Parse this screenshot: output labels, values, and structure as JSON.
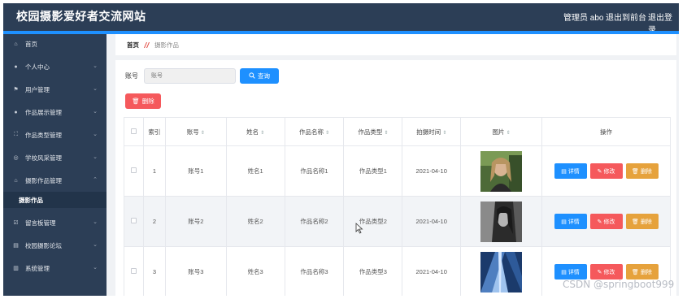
{
  "header": {
    "site_title": "校园摄影爱好者交流网站",
    "admin_label": "管理员 abo",
    "front_link": "退出到前台",
    "logout_link": "退出登录"
  },
  "sidebar": {
    "items": [
      {
        "label": "首页",
        "icon": "home-icon"
      },
      {
        "label": "个人中心",
        "icon": "user-icon"
      },
      {
        "label": "用户管理",
        "icon": "flag-icon"
      },
      {
        "label": "作品展示管理",
        "icon": "user-icon"
      },
      {
        "label": "作品类型管理",
        "icon": "fullscreen-icon"
      },
      {
        "label": "学校风采管理",
        "icon": "compass-icon"
      },
      {
        "label": "摄影作品管理",
        "icon": "bank-icon"
      },
      {
        "label": "摄影作品",
        "icon": ""
      },
      {
        "label": "留言板管理",
        "icon": "checkbox-icon"
      },
      {
        "label": "校园摄影论坛",
        "icon": "document-icon"
      },
      {
        "label": "系统管理",
        "icon": "chart-icon"
      }
    ]
  },
  "breadcrumb": {
    "home": "首页",
    "current": "摄影作品"
  },
  "search": {
    "label": "账号",
    "placeholder": "账号",
    "query_button": "查询"
  },
  "toolbar": {
    "delete_button": "删除"
  },
  "table": {
    "headers": [
      "索引",
      "账号",
      "姓名",
      "作品名称",
      "作品类型",
      "拍摄时间",
      "图片",
      "操作"
    ],
    "rows": [
      {
        "index": "1",
        "account": "账号1",
        "name": "姓名1",
        "work_name": "作品名称1",
        "work_type": "作品类型1",
        "date": "2021-04-10"
      },
      {
        "index": "2",
        "account": "账号2",
        "name": "姓名2",
        "work_name": "作品名称2",
        "work_type": "作品类型2",
        "date": "2021-04-10"
      },
      {
        "index": "3",
        "account": "账号3",
        "name": "姓名3",
        "work_name": "作品名称3",
        "work_type": "作品类型3",
        "date": "2021-04-10"
      }
    ],
    "actions": {
      "detail": "详情",
      "edit": "修改",
      "delete": "删除"
    }
  },
  "watermark": "CSDN @springboot999",
  "colors": {
    "sidebar_bg": "#2c3e56",
    "accent_blue": "#1e90ff",
    "danger_red": "#f5595c",
    "warning_orange": "#e6a23c"
  }
}
